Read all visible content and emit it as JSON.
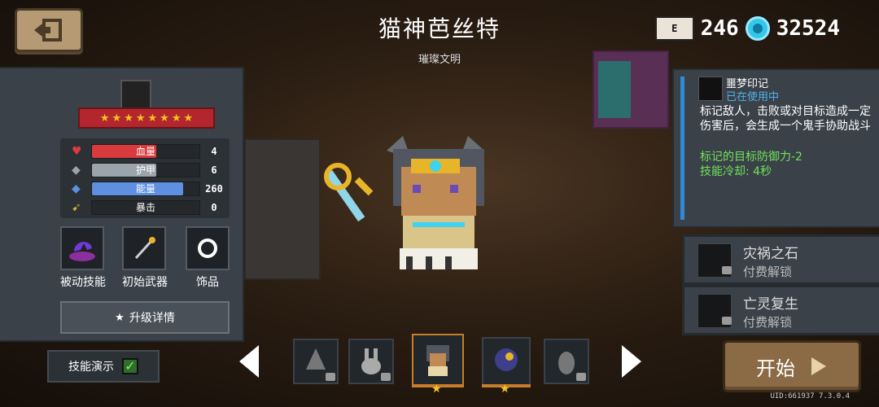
{
  "header": {
    "title": "猫神芭丝特",
    "subtitle": "璀璨文明"
  },
  "currency": {
    "energy_icon_label": "E",
    "energy_value": "246",
    "gem_value": "32524"
  },
  "stats": [
    {
      "name": "血量",
      "value": "4",
      "color": "#d93a3e",
      "fill": 0.6
    },
    {
      "name": "护甲",
      "value": "6",
      "color": "#9ba3ab",
      "fill": 0.6
    },
    {
      "name": "能量",
      "value": "260",
      "color": "#5e8fe0",
      "fill": 0.85
    },
    {
      "name": "暴击",
      "value": "0",
      "color": "#d9b23a",
      "fill": 0
    }
  ],
  "stars": 8,
  "skills": {
    "passive_label": "被动技能",
    "weapon_label": "初始武器",
    "accessory_label": "饰品"
  },
  "upgrade_label": "升级详情",
  "skill_demo_label": "技能演示",
  "skill_demo_checked": true,
  "skill_info": {
    "name": "噩梦印记",
    "status": "已在使用中",
    "description": "标记敌人，击败或对目标造成一定伤害后，会生成一个鬼手协助战斗",
    "effect": "标记的目标防御力-2",
    "cooldown": "技能冷却: 4秒"
  },
  "unlock_cards": [
    {
      "name": "灾祸之石",
      "sub": "付费解锁"
    },
    {
      "name": "亡灵复生",
      "sub": "付费解锁"
    }
  ],
  "start_label": "开始",
  "uid": "UID:661937 7.3.0.4",
  "colors": {
    "accent_blue": "#2f8ad8",
    "start_brown": "#8b6b45",
    "ribbon_red": "#b3262d",
    "green_text": "#6fe35b"
  }
}
